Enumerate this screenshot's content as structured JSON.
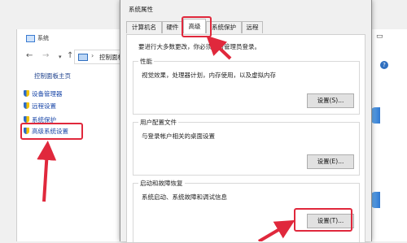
{
  "background_window": {
    "title": "系统",
    "address": {
      "sep": "›",
      "path": "控制面板"
    },
    "sidebar": {
      "title": "控制面板主页",
      "items": [
        {
          "label": "设备管理器"
        },
        {
          "label": "远程设置"
        },
        {
          "label": "系统保护"
        },
        {
          "label": "高级系统设置"
        }
      ]
    }
  },
  "dialog": {
    "title": "系统属性",
    "tabs": [
      {
        "label": "计算机名"
      },
      {
        "label": "硬件"
      },
      {
        "label": "高级",
        "selected": true
      },
      {
        "label": "系统保护"
      },
      {
        "label": "远程"
      }
    ],
    "notice": "要进行大多数更改，你必须作为管理员登录。",
    "groups": [
      {
        "label": "性能",
        "desc": "视觉效果，处理器计划，内存使用，以及虚拟内存",
        "button": "设置(S)..."
      },
      {
        "label": "用户配置文件",
        "desc": "与登录帐户相关的桌面设置",
        "button": "设置(E)..."
      },
      {
        "label": "启动和故障恢复",
        "desc": "系统启动、系统故障和调试信息",
        "button": "设置(T)..."
      }
    ]
  },
  "colors": {
    "highlight": "#e0283c",
    "link": "#1a47a8",
    "accent": "#2f6fbf"
  },
  "icons": [
    "shield-icon",
    "back-arrow-icon",
    "forward-arrow-icon",
    "up-arrow-icon",
    "computer-icon",
    "help-icon"
  ]
}
